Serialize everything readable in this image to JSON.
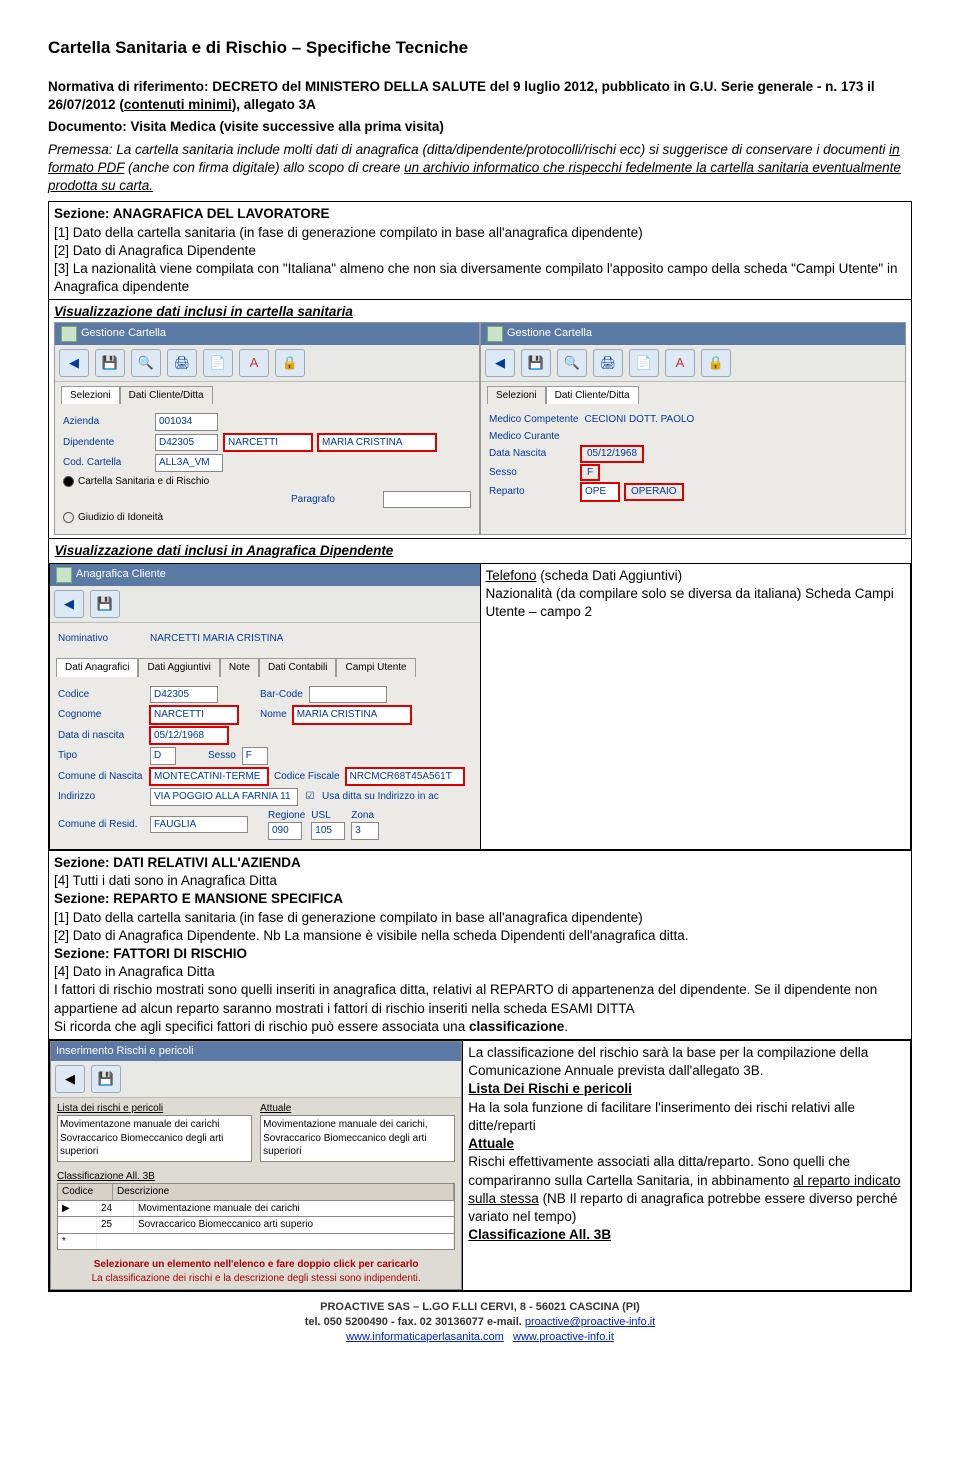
{
  "doc_title": "Cartella Sanitaria e di Rischio – Specifiche Tecniche",
  "normativa": "Normativa di riferimento: DECRETO del MINISTERO DELLA SALUTE del 9 luglio 2012, pubblicato in G.U. Serie generale - n. 173 il 26/07/2012 (",
  "normativa_u": "contenuti minimi",
  "normativa_end": "), allegato 3A",
  "doc_line": "Documento: Visita Medica (visite successive alla prima visita)",
  "premessa_pre": "Premessa: La cartella sanitaria include molti dati di anagrafica (ditta/dipendente/protocolli/rischi ecc) si suggerisce di conservare i documenti ",
  "premessa_u1": "in formato PDF",
  "premessa_mid": " (anche con firma digitale) allo scopo di creare ",
  "premessa_u2": "un archivio informatico che rispecchi fedelmente la cartella sanitaria eventualmente prodotta su carta.",
  "sez1_title": "Sezione: ANAGRAFICA DEL LAVORATORE",
  "sez1_l1": "[1] Dato della cartella sanitaria (in fase di generazione compilato in base all'anagrafica dipendente)",
  "sez1_l2": "[2] Dato di Anagrafica Dipendente",
  "sez1_l3": "[3] La nazionalità viene compilata con \"Italiana\" almeno che non sia diversamente compilato l'apposito campo della scheda \"Campi Utente\" in Anagrafica dipendente",
  "vis1": "Visualizzazione dati inclusi in cartella sanitaria",
  "vis2": "Visualizzazione dati inclusi in Anagrafica Dipendente",
  "vis2_r1": "Telefono",
  "vis2_r1b": " (scheda Dati Aggiuntivi)",
  "vis2_r2": "Nazionalità (da compilare solo se diversa da italiana) Scheda Campi Utente – campo 2",
  "shot_gc": "Gestione Cartella",
  "shot_sel": "Selezioni",
  "shot_dcd": "Dati Cliente/Ditta",
  "shot_az": "Azienda",
  "shot_az_v": "001034",
  "shot_dip": "Dipendente",
  "shot_dip_v": "D42305",
  "shot_cognome_v": "NARCETTI",
  "shot_nome_v": "MARIA CRISTINA",
  "shot_cod": "Cod. Cartella",
  "shot_cod_v": "ALL3A_VM",
  "shot_r1": "Cartella Sanitaria e di Rischio",
  "shot_r2": "Giudizio di Idoneità",
  "shot_para": "Paragrafo",
  "shot_mc": "Medico Competente",
  "shot_mc_v": "CECIONI DOTT. PAOLO",
  "shot_mcu": "Medico Curante",
  "shot_dn": "Data Nascita",
  "shot_dn_v": "05/12/1968",
  "shot_sesso": "Sesso",
  "shot_sesso_v": "F",
  "shot_rep": "Reparto",
  "shot_rep_v": "OPE",
  "shot_rep_v2": "OPERAIO",
  "ana_title": "Anagrafica Cliente",
  "ana_nom": "Nominativo",
  "ana_nom_v": "NARCETTI MARIA CRISTINA",
  "ana_tabs": [
    "Dati Anagrafici",
    "Dati Aggiuntivi",
    "Note",
    "Dati Contabili",
    "Campi Utente"
  ],
  "ana_codice": "Codice",
  "ana_codice_v": "D42305",
  "ana_barcode": "Bar-Code",
  "ana_cogn": "Cognome",
  "ana_cogn_v": "NARCETTI",
  "ana_nome": "Nome",
  "ana_nome_v": "MARIA CRISTINA",
  "ana_dnas": "Data di nascita",
  "ana_dnas_v": "05/12/1968",
  "ana_tipo": "Tipo",
  "ana_tipo_v": "D",
  "ana_sex": "Sesso",
  "ana_sex_v": "F",
  "ana_comn": "Comune di Nascita",
  "ana_comn_v": "MONTECATINI-TERME",
  "ana_cf": "Codice Fiscale",
  "ana_cf_v": "NRCMCR68T45A561T",
  "ana_ind": "Indirizzo",
  "ana_ind_v": "VIA POGGIO ALLA FARNIA 11",
  "ana_usa": "Usa ditta su Indirizzo in ac",
  "ana_comr": "Comune di Resid.",
  "ana_comr_v": "FAUGLIA",
  "ana_reg": "Regione",
  "ana_usl": "USL",
  "ana_zona": "Zona",
  "ana_reg_v": "090",
  "ana_usl_v": "105",
  "ana_zona_v": "3",
  "sez2_t": "Sezione: DATI RELATIVI ALL'AZIENDA",
  "sez2_l": "[4] Tutti i dati sono in Anagrafica Ditta",
  "sez3_t": "Sezione: REPARTO E MANSIONE SPECIFICA",
  "sez3_l1": "[1] Dato della cartella sanitaria (in fase di generazione compilato in base all'anagrafica dipendente)",
  "sez3_l2": "[2] Dato di Anagrafica Dipendente. Nb La mansione è visibile nella scheda Dipendenti dell'anagrafica ditta.",
  "sez4_t": "Sezione: FATTORI DI RISCHIO",
  "sez4_l1": "[4] Dato in Anagrafica Ditta",
  "sez4_l2": "I fattori di rischio mostrati sono quelli inseriti in anagrafica ditta, relativi al REPARTO di appartenenza del dipendente. Se il dipendente non appartiene ad alcun reparto saranno mostrati i fattori di rischio inseriti nella scheda ESAMI DITTA",
  "sez4_l3": "Si ricorda che agli specifici fattori di rischio può essere associata una ",
  "sez4_l3b": "classificazione",
  "r_title": "Inserimento Rischi e pericoli",
  "r_l": "Lista dei rischi e pericoli",
  "r_a": "Attuale",
  "r_i1": "Movimentazone manuale dei carichi",
  "r_i2": "Sovraccarico Biomeccanico degli arti superiori",
  "r_a1": "Movimentazione manuale dei carichi, Sovraccarico Biomeccanico degli arti superiori",
  "r_ch": "Classificazione All. 3B",
  "r_c1": "Codice",
  "r_c2": "Descrizione",
  "r_r1a": "24",
  "r_r1b": "Movimentazione manuale dei carichi",
  "r_r2a": "25",
  "r_r2b": "Sovraccarico Biomeccanico arti superio",
  "r_foot1": "Selezionare un elemento nell'elenco e fare doppio click per caricarlo",
  "r_foot2": "La classificazione dei rischi e la descrizione degli stessi sono indipendenti.",
  "side1": "La classificazione del rischio sarà la base per la compilazione della Comunicazione Annuale prevista dall'allegato 3B.",
  "side2": "Lista Dei Rischi e pericoli",
  "side3": "Ha la sola funzione di facilitare l'inserimento dei rischi relativi alle ditte/reparti",
  "side4": "Attuale",
  "side5": "Rischi effettivamente associati alla ditta/reparto. Sono quelli che compariranno sulla Cartella Sanitaria, in abbinamento ",
  "side5u": "al reparto indicato sulla stessa",
  "side5b": " (NB Il reparto di anagrafica potrebbe essere diverso perché variato nel tempo)",
  "side6": "Classificazione All. 3B",
  "foot1": "PROACTIVE SAS – L.GO F.LLI CERVI, 8 - 56021 CASCINA (PI)",
  "foot2a": "tel. 050 5200490 - fax. 02 30136077  e-mail. ",
  "foot2b": "proactive@proactive-info.it",
  "foot3a": "www.informaticaperlasanita.com",
  "foot3b": "www.proactive-info.it"
}
